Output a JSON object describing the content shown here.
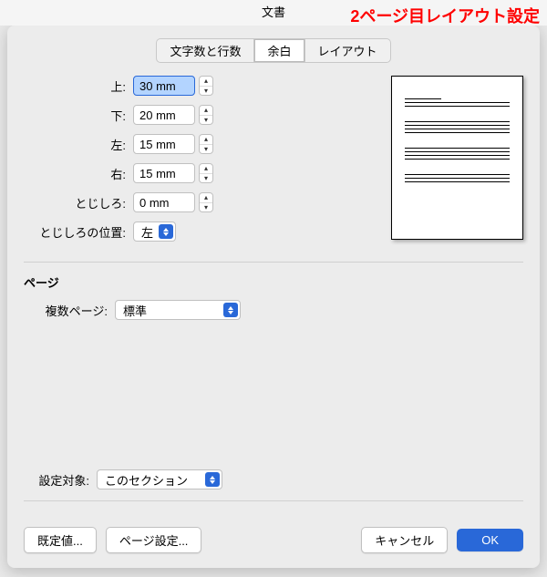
{
  "title": "文書",
  "annotation": "2ページ目レイアウト設定",
  "tabs": {
    "chars_lines": "文字数と行数",
    "margins": "余白",
    "layout": "レイアウト"
  },
  "margins": {
    "top": {
      "label": "上:",
      "value": "30 mm"
    },
    "bottom": {
      "label": "下:",
      "value": "20 mm"
    },
    "left": {
      "label": "左:",
      "value": "15 mm"
    },
    "right": {
      "label": "右:",
      "value": "15 mm"
    },
    "gutter": {
      "label": "とじしろ:",
      "value": "0 mm"
    },
    "gutter_pos": {
      "label": "とじしろの位置:",
      "value": "左"
    }
  },
  "page": {
    "section_title": "ページ",
    "multi_label": "複数ページ:",
    "multi_value": "標準"
  },
  "apply": {
    "label": "設定対象:",
    "value": "このセクション"
  },
  "buttons": {
    "defaults": "既定値...",
    "page_setup": "ページ設定...",
    "cancel": "キャンセル",
    "ok": "OK"
  }
}
